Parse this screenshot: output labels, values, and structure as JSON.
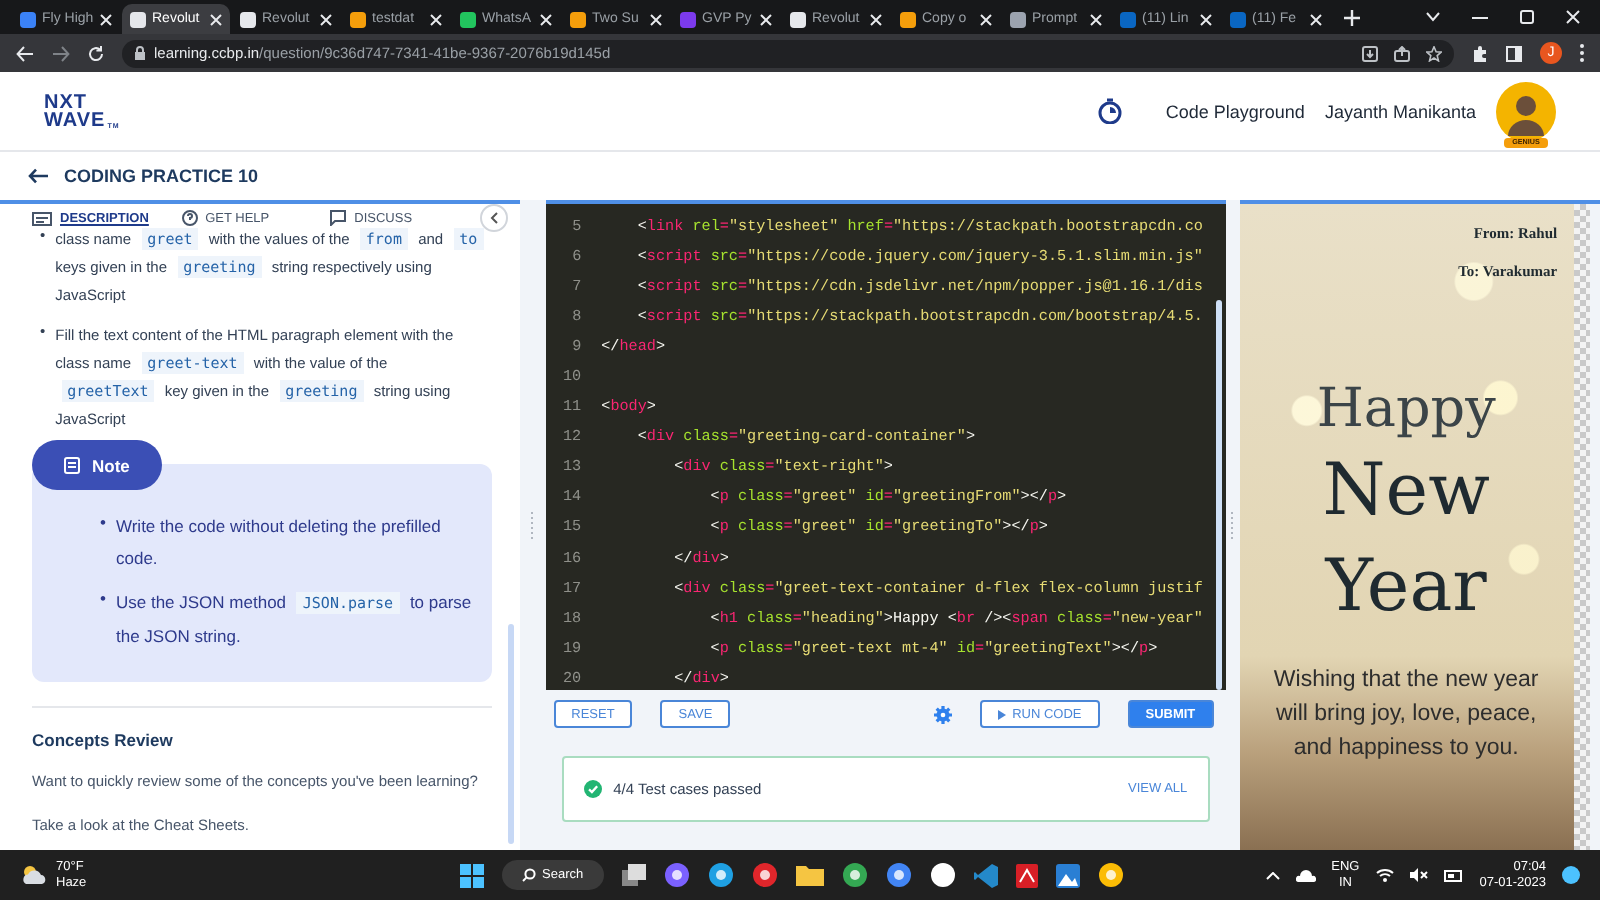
{
  "browser": {
    "tabs": [
      {
        "title": "Fly High",
        "color": "#3b82f6",
        "selected": false
      },
      {
        "title": "Revolut",
        "color": "#e5e7eb",
        "selected": true
      },
      {
        "title": "Revolut",
        "color": "#e5e7eb",
        "selected": false
      },
      {
        "title": "testdat",
        "color": "#f59e0b",
        "selected": false
      },
      {
        "title": "WhatsA",
        "color": "#22c55e",
        "selected": false
      },
      {
        "title": "Two Su",
        "color": "#f59e0b",
        "selected": false
      },
      {
        "title": "GVP Py",
        "color": "#7c3aed",
        "selected": false
      },
      {
        "title": "Revolut",
        "color": "#e5e7eb",
        "selected": false
      },
      {
        "title": "Copy o",
        "color": "#f59e0b",
        "selected": false
      },
      {
        "title": "Prompt",
        "color": "#9ca3af",
        "selected": false
      },
      {
        "title": "(11) Lin",
        "color": "#0a66c2",
        "selected": false
      },
      {
        "title": "(11) Fe",
        "color": "#0a66c2",
        "selected": false
      }
    ],
    "url_domain": "learning.ccbp.in",
    "url_path": "/question/9c36d747-7341-41be-9367-2076b19d145d",
    "profile_initial": "J"
  },
  "header": {
    "logo_top": "NXT",
    "logo_bottom": "WAVE",
    "logo_mark": "TM",
    "nav_link": "Code Playground",
    "user_name": "Jayanth Manikanta",
    "avatar_badge": "GENIUS"
  },
  "page_title": "CODING PRACTICE 10",
  "left_panel": {
    "tabs": [
      {
        "label": "DESCRIPTION",
        "selected": true
      },
      {
        "label": "GET HELP",
        "selected": false
      },
      {
        "label": "DISCUSS",
        "selected": false
      }
    ],
    "bullets": [
      {
        "marker": "•",
        "parts": [
          {
            "kind": "text",
            "text": "class name"
          },
          {
            "kind": "code",
            "text": "greet"
          },
          {
            "kind": "text",
            "text": "with the values of the"
          },
          {
            "kind": "code",
            "text": "from"
          },
          {
            "kind": "text",
            "text": "and"
          },
          {
            "kind": "code",
            "text": "to"
          },
          {
            "kind": "text",
            "text": "keys given in the"
          },
          {
            "kind": "code",
            "text": "greeting"
          },
          {
            "kind": "text",
            "text": "string respectively using JavaScript"
          }
        ]
      },
      {
        "marker": "•",
        "parts": [
          {
            "kind": "text",
            "text": "Fill the text content of the HTML paragraph element with the class name"
          },
          {
            "kind": "code",
            "text": "greet-text"
          },
          {
            "kind": "text",
            "text": "with the value of the"
          },
          {
            "kind": "code",
            "text": "greetText"
          },
          {
            "kind": "text",
            "text": "key given in the"
          },
          {
            "kind": "code",
            "text": "greeting"
          },
          {
            "kind": "text",
            "text": "string using JavaScript"
          }
        ]
      }
    ],
    "note": {
      "title": "Note",
      "bullets": [
        {
          "marker": "•",
          "parts": [
            {
              "kind": "text",
              "text": "Write the code without deleting the prefilled code."
            }
          ]
        },
        {
          "marker": "•",
          "parts": [
            {
              "kind": "text",
              "text": "Use the JSON method"
            },
            {
              "kind": "code",
              "text": "JSON.parse"
            },
            {
              "kind": "text",
              "text": "to parse the JSON string."
            }
          ]
        }
      ]
    },
    "concepts": {
      "title": "Concepts Review",
      "paragraphs": [
        "Want to quickly review some of the concepts you've been learning?",
        "Take a look at the Cheat Sheets."
      ]
    }
  },
  "editor": {
    "lines": [
      {
        "number": "5",
        "tokens": [
          {
            "kind": "plain",
            "text": "    <"
          },
          {
            "kind": "tag",
            "text": "link"
          },
          {
            "kind": "attr",
            "text": " rel"
          },
          {
            "kind": "op",
            "text": "="
          },
          {
            "kind": "str",
            "text": "\"stylesheet\""
          },
          {
            "kind": "attr",
            "text": " href"
          },
          {
            "kind": "op",
            "text": "="
          },
          {
            "kind": "str",
            "text": "\"https://stackpath.bootstrapcdn.co"
          }
        ]
      },
      {
        "number": "6",
        "tokens": [
          {
            "kind": "plain",
            "text": "    <"
          },
          {
            "kind": "tag",
            "text": "script"
          },
          {
            "kind": "attr",
            "text": " src"
          },
          {
            "kind": "op",
            "text": "="
          },
          {
            "kind": "str",
            "text": "\"https://code.jquery.com/jquery-3.5.1.slim.min.js\""
          }
        ]
      },
      {
        "number": "7",
        "tokens": [
          {
            "kind": "plain",
            "text": "    <"
          },
          {
            "kind": "tag",
            "text": "script"
          },
          {
            "kind": "attr",
            "text": " src"
          },
          {
            "kind": "op",
            "text": "="
          },
          {
            "kind": "str",
            "text": "\"https://cdn.jsdelivr.net/npm/popper.js@1.16.1/dis"
          }
        ]
      },
      {
        "number": "8",
        "tokens": [
          {
            "kind": "plain",
            "text": "    <"
          },
          {
            "kind": "tag",
            "text": "script"
          },
          {
            "kind": "attr",
            "text": " src"
          },
          {
            "kind": "op",
            "text": "="
          },
          {
            "kind": "str",
            "text": "\"https://stackpath.bootstrapcdn.com/bootstrap/4.5."
          }
        ]
      },
      {
        "number": "9",
        "tokens": [
          {
            "kind": "plain",
            "text": "</"
          },
          {
            "kind": "tag",
            "text": "head"
          },
          {
            "kind": "plain",
            "text": ">"
          }
        ]
      },
      {
        "number": "10"
      },
      {
        "number": "11",
        "tokens": [
          {
            "kind": "plain",
            "text": "<"
          },
          {
            "kind": "tag",
            "text": "body"
          },
          {
            "kind": "plain",
            "text": ">"
          }
        ]
      },
      {
        "number": "12",
        "tokens": [
          {
            "kind": "plain",
            "text": "    <"
          },
          {
            "kind": "tag",
            "text": "div"
          },
          {
            "kind": "attr",
            "text": " class"
          },
          {
            "kind": "op",
            "text": "="
          },
          {
            "kind": "str",
            "text": "\"greeting-card-container\""
          },
          {
            "kind": "plain",
            "text": ">"
          }
        ]
      },
      {
        "number": "13",
        "tokens": [
          {
            "kind": "plain",
            "text": "        <"
          },
          {
            "kind": "tag",
            "text": "div"
          },
          {
            "kind": "attr",
            "text": " class"
          },
          {
            "kind": "op",
            "text": "="
          },
          {
            "kind": "str",
            "text": "\"text-right\""
          },
          {
            "kind": "plain",
            "text": ">"
          }
        ]
      },
      {
        "number": "14",
        "tokens": [
          {
            "kind": "plain",
            "text": "            <"
          },
          {
            "kind": "tag",
            "text": "p"
          },
          {
            "kind": "attr",
            "text": " class"
          },
          {
            "kind": "op",
            "text": "="
          },
          {
            "kind": "str",
            "text": "\"greet\""
          },
          {
            "kind": "attr",
            "text": " id"
          },
          {
            "kind": "op",
            "text": "="
          },
          {
            "kind": "str",
            "text": "\"greetingFrom\""
          },
          {
            "kind": "plain",
            "text": "></"
          },
          {
            "kind": "tag",
            "text": "p"
          },
          {
            "kind": "plain",
            "text": ">"
          }
        ]
      },
      {
        "number": "15",
        "tokens": [
          {
            "kind": "plain",
            "text": "            <"
          },
          {
            "kind": "tag",
            "text": "p"
          },
          {
            "kind": "attr",
            "text": " class"
          },
          {
            "kind": "op",
            "text": "="
          },
          {
            "kind": "str",
            "text": "\"greet\""
          },
          {
            "kind": "attr",
            "text": " id"
          },
          {
            "kind": "op",
            "text": "="
          },
          {
            "kind": "str",
            "text": "\"greetingTo\""
          },
          {
            "kind": "plain",
            "text": "></"
          },
          {
            "kind": "tag",
            "text": "p"
          },
          {
            "kind": "plain",
            "text": ">"
          }
        ]
      },
      {
        "number": "16",
        "tokens": [
          {
            "kind": "plain",
            "text": "        </"
          },
          {
            "kind": "tag",
            "text": "div"
          },
          {
            "kind": "plain",
            "text": ">"
          }
        ]
      },
      {
        "number": "17",
        "tokens": [
          {
            "kind": "plain",
            "text": "        <"
          },
          {
            "kind": "tag",
            "text": "div"
          },
          {
            "kind": "attr",
            "text": " class"
          },
          {
            "kind": "op",
            "text": "="
          },
          {
            "kind": "str",
            "text": "\"greet-text-container d-flex flex-column justif"
          }
        ]
      },
      {
        "number": "18",
        "tokens": [
          {
            "kind": "plain",
            "text": "            <"
          },
          {
            "kind": "tag",
            "text": "h1"
          },
          {
            "kind": "attr",
            "text": " class"
          },
          {
            "kind": "op",
            "text": "="
          },
          {
            "kind": "str",
            "text": "\"heading\""
          },
          {
            "kind": "plain",
            "text": ">Happy <"
          },
          {
            "kind": "tag",
            "text": "br"
          },
          {
            "kind": "plain",
            "text": " /><"
          },
          {
            "kind": "tag",
            "text": "span"
          },
          {
            "kind": "attr",
            "text": " class"
          },
          {
            "kind": "op",
            "text": "="
          },
          {
            "kind": "str",
            "text": "\"new-year\""
          }
        ]
      },
      {
        "number": "19",
        "tokens": [
          {
            "kind": "plain",
            "text": "            <"
          },
          {
            "kind": "tag",
            "text": "p"
          },
          {
            "kind": "attr",
            "text": " class"
          },
          {
            "kind": "op",
            "text": "="
          },
          {
            "kind": "str",
            "text": "\"greet-text mt-4\""
          },
          {
            "kind": "attr",
            "text": " id"
          },
          {
            "kind": "op",
            "text": "="
          },
          {
            "kind": "str",
            "text": "\"greetingText\""
          },
          {
            "kind": "plain",
            "text": "></"
          },
          {
            "kind": "tag",
            "text": "p"
          },
          {
            "kind": "plain",
            "text": ">"
          }
        ]
      },
      {
        "number": "20",
        "tokens": [
          {
            "kind": "plain",
            "text": "        </"
          },
          {
            "kind": "tag",
            "text": "div"
          },
          {
            "kind": "plain",
            "text": ">"
          }
        ]
      }
    ],
    "buttons": {
      "reset": "RESET",
      "save": "SAVE",
      "run": "RUN CODE",
      "submit": "SUBMIT"
    },
    "result": {
      "text": "4/4 Test cases passed",
      "link": "VIEW ALL"
    }
  },
  "preview": {
    "from": "From: Rahul",
    "to": "To: Varakumar",
    "heading": [
      "Happy",
      "New",
      "Year"
    ],
    "message": "Wishing that the new year will bring joy, love, peace, and happiness to you."
  },
  "taskbar": {
    "temperature": "70°F",
    "weather": "Haze",
    "search": "Search",
    "language": "ENG",
    "region": "IN",
    "time": "07:04",
    "date": "07-01-2023"
  }
}
